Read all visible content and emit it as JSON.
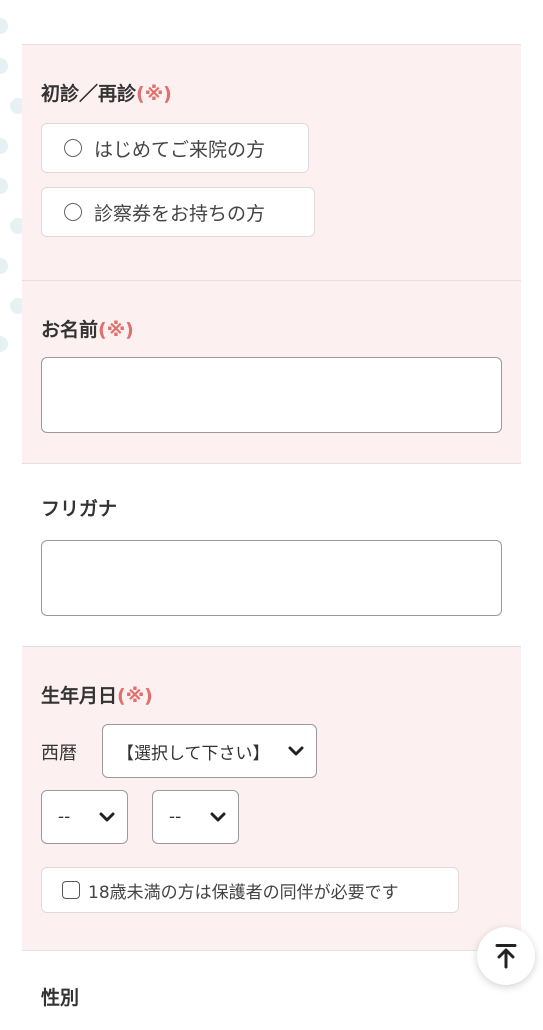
{
  "visit_type": {
    "label": "初診／再診",
    "required_mark": "(※)",
    "options": [
      "はじめてご来院の方",
      "診察券をお持ちの方"
    ]
  },
  "name": {
    "label": "お名前",
    "required_mark": "(※)",
    "value": ""
  },
  "furigana": {
    "label": "フリガナ",
    "value": ""
  },
  "birthdate": {
    "label": "生年月日",
    "required_mark": "(※)",
    "era_label": "西暦",
    "year_select": "【選択して下さい】",
    "month_select": "--",
    "day_select": "--",
    "guardian_note": "18歳未満の方は保護者の同伴が必要です"
  },
  "gender": {
    "label": "性別"
  },
  "colors": {
    "section_pink": "#fcf0f0",
    "required_red": "#e0706c",
    "dot_blue": "#e6f1f4"
  },
  "icons": {
    "scroll_top": "arrow-up-to-top-icon",
    "dropdown": "chevron-down-icon",
    "radio": "radio-circle-icon",
    "checkbox": "checkbox-icon"
  }
}
